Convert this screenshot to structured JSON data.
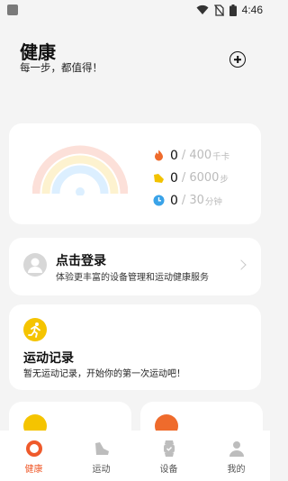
{
  "status_bar": {
    "time": "4:46"
  },
  "header": {
    "title": "健康",
    "subtitle": "每一步，都值得！"
  },
  "summary": {
    "metrics": [
      {
        "icon": "flame-icon",
        "value": "0",
        "separator": "/",
        "target": "400",
        "unit": "千卡",
        "color": "#ef6b2c"
      },
      {
        "icon": "shoe-icon",
        "value": "0",
        "separator": "/",
        "target": "6000",
        "unit": "步",
        "color": "#f2c200"
      },
      {
        "icon": "clock-icon",
        "value": "0",
        "separator": "/",
        "target": "30",
        "unit": "分钟",
        "color": "#3aa3e8"
      }
    ],
    "rainbow_colors": [
      "#fce0d9",
      "#fdf2cf",
      "#dcefff"
    ]
  },
  "login": {
    "title": "点击登录",
    "description": "体验更丰富的设备管理和运动健康服务"
  },
  "record": {
    "title": "运动记录",
    "description": "暂无运动记录，开始你的第一次运动吧！"
  },
  "tabs": [
    {
      "icon": "health-ring-icon",
      "label": "健康",
      "active": true
    },
    {
      "icon": "sneaker-icon",
      "label": "运动",
      "active": false
    },
    {
      "icon": "watch-icon",
      "label": "设备",
      "active": false
    },
    {
      "icon": "profile-icon",
      "label": "我的",
      "active": false
    }
  ],
  "colors": {
    "accent": "#ef5a2b",
    "background": "#f4f4f4",
    "card": "#ffffff"
  }
}
